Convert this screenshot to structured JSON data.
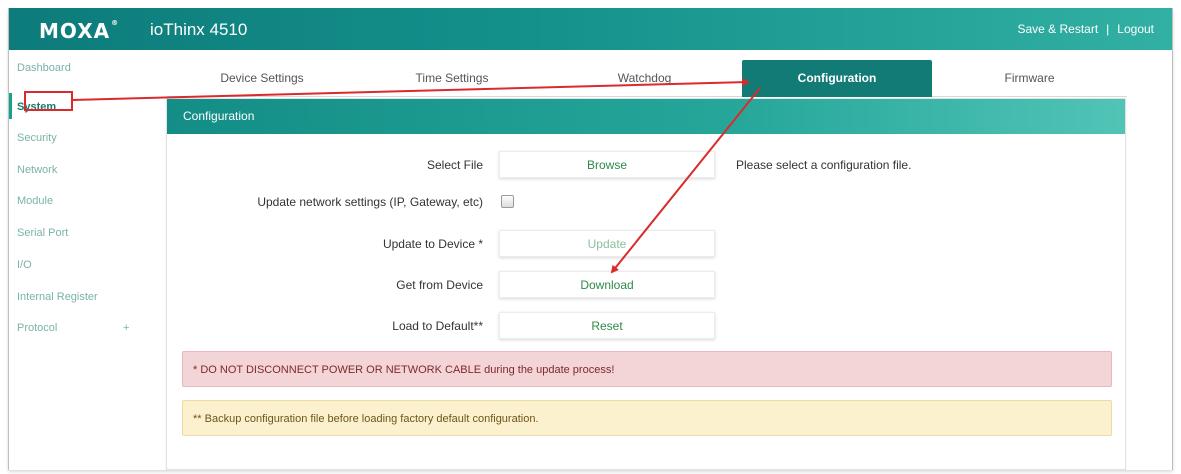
{
  "header": {
    "logo_text": "MOXA",
    "logo_registered": "®",
    "product_name": "ioThinx 4510",
    "save_restart": "Save & Restart",
    "separator": "|",
    "logout": "Logout"
  },
  "sidebar": {
    "items": [
      {
        "label": "Dashboard"
      },
      {
        "label": "System"
      },
      {
        "label": "Security"
      },
      {
        "label": "Network"
      },
      {
        "label": "Module"
      },
      {
        "label": "Serial Port"
      },
      {
        "label": "I/O"
      },
      {
        "label": "Internal Register"
      },
      {
        "label": "Protocol"
      }
    ],
    "active": "System",
    "expand_symbol": "+"
  },
  "tabs": [
    {
      "label": "Device Settings"
    },
    {
      "label": "Time Settings"
    },
    {
      "label": "Watchdog"
    },
    {
      "label": "Configuration"
    },
    {
      "label": "Firmware"
    }
  ],
  "active_tab": "Configuration",
  "panel": {
    "title": "Configuration",
    "rows": {
      "select_file": {
        "label": "Select File",
        "button": "Browse",
        "hint": "Please select a configuration file."
      },
      "update_network": {
        "label": "Update network settings (IP, Gateway, etc)",
        "checked": false
      },
      "update_device": {
        "label": "Update to Device *",
        "button": "Update",
        "enabled": false
      },
      "get_device": {
        "label": "Get from Device",
        "button": "Download"
      },
      "load_default": {
        "label": "Load to Default**",
        "button": "Reset"
      }
    },
    "alerts": {
      "danger": "* DO NOT DISCONNECT POWER OR NETWORK CABLE during the update process!",
      "warning": "** Backup configuration file before loading factory default configuration."
    }
  },
  "colors": {
    "brand_dark": "#0d7b7b",
    "brand_light": "#51c4b6",
    "active_tab": "#137b76",
    "button_text": "#2f8a4a",
    "annotation": "#d92b2b"
  },
  "icons": {
    "logo": "moxa-logo",
    "checkbox": "checkbox",
    "annotation_arrow": "arrow-icon"
  }
}
